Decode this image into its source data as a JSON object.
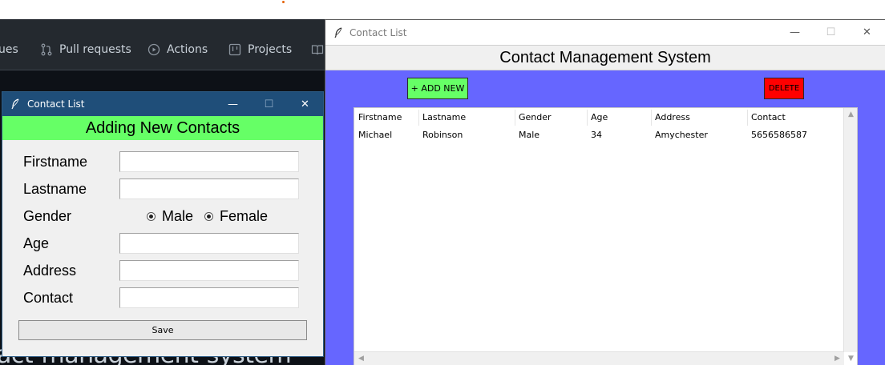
{
  "background_page": {
    "nav": [
      {
        "label": "ues",
        "icon": "issues-icon"
      },
      {
        "label": "Pull requests",
        "icon": "pull-request-icon"
      },
      {
        "label": "Actions",
        "icon": "play-icon"
      },
      {
        "label": "Projects",
        "icon": "project-icon"
      }
    ],
    "heading": "act-management-system"
  },
  "main_window": {
    "title": "Contact List",
    "header": "Contact Management System",
    "add_button": "+ ADD NEW",
    "delete_button": "DELETE",
    "columns": [
      "Firstname",
      "Lastname",
      "Gender",
      "Age",
      "Address",
      "Contact"
    ],
    "rows": [
      [
        "Michael",
        "Robinson",
        "Male",
        "34",
        "Amychester",
        "5656586587"
      ]
    ],
    "colors": {
      "body": "#6666ff",
      "add": "#66ff66",
      "delete": "#ff0000"
    }
  },
  "form_window": {
    "title": "Contact List",
    "header": "Adding New Contacts",
    "labels": {
      "firstname": "Firstname",
      "lastname": "Lastname",
      "gender": "Gender",
      "age": "Age",
      "address": "Address",
      "contact": "Contact"
    },
    "gender_options": {
      "male": "Male",
      "female": "Female"
    },
    "save_button": "Save",
    "colors": {
      "header": "#66ff66",
      "titlebar": "#1f4e79"
    }
  }
}
